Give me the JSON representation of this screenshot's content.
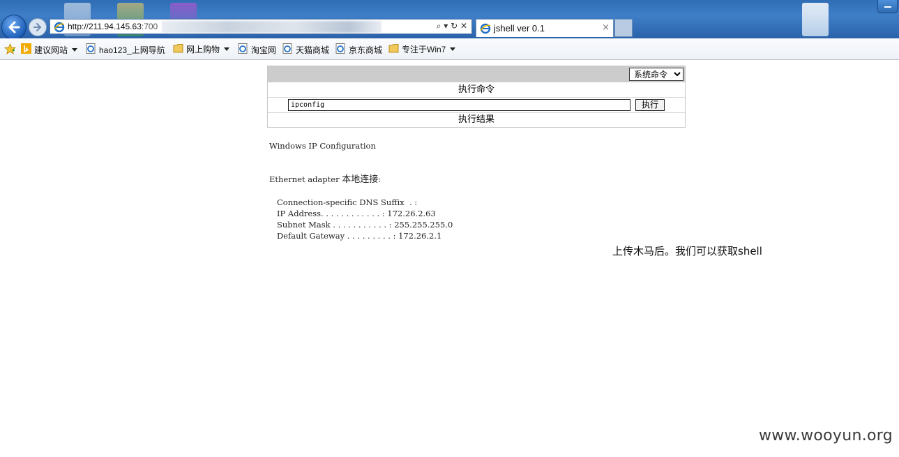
{
  "browser": {
    "address_url_host": "http://211.94.145.63",
    "address_url_port": ":700",
    "tab_title": "jshell ver 0.1",
    "tab_close": "×",
    "address_tools": "⌕ ▾ ↻ ✕"
  },
  "favorites": [
    {
      "label": "建议网站",
      "icon": "bing-icon",
      "dropdown": true
    },
    {
      "label": "hao123_上网导航",
      "icon": "ie-page-icon",
      "dropdown": false
    },
    {
      "label": "网上购物",
      "icon": "folder-icon",
      "dropdown": true
    },
    {
      "label": "淘宝网",
      "icon": "ie-page-icon",
      "dropdown": false
    },
    {
      "label": "天猫商城",
      "icon": "ie-page-icon",
      "dropdown": false
    },
    {
      "label": "京东商城",
      "icon": "ie-page-icon",
      "dropdown": false
    },
    {
      "label": "专注于Win7",
      "icon": "folder-icon",
      "dropdown": true
    }
  ],
  "shell": {
    "mode_select": "系统命令",
    "exec_header": "执行命令",
    "command_value": "ipconfig",
    "exec_button": "执行",
    "result_header": "执行结果"
  },
  "result": {
    "line1": "Windows IP Configuration",
    "adapter_prefix": "Ethernet adapter ",
    "adapter_name": "本地连接",
    "adapter_suffix": ":",
    "dns": "   Connection-specific DNS Suffix  . :",
    "ip": "   IP Address. . . . . . . . . . . . : 172.26.2.63",
    "mask": "   Subnet Mask . . . . . . . . . . . : 255.255.255.0",
    "gateway": "   Default Gateway . . . . . . . . . : 172.26.2.1"
  },
  "caption": "上传木马后。我们可以获取shell",
  "watermark": "www.wooyun.org"
}
